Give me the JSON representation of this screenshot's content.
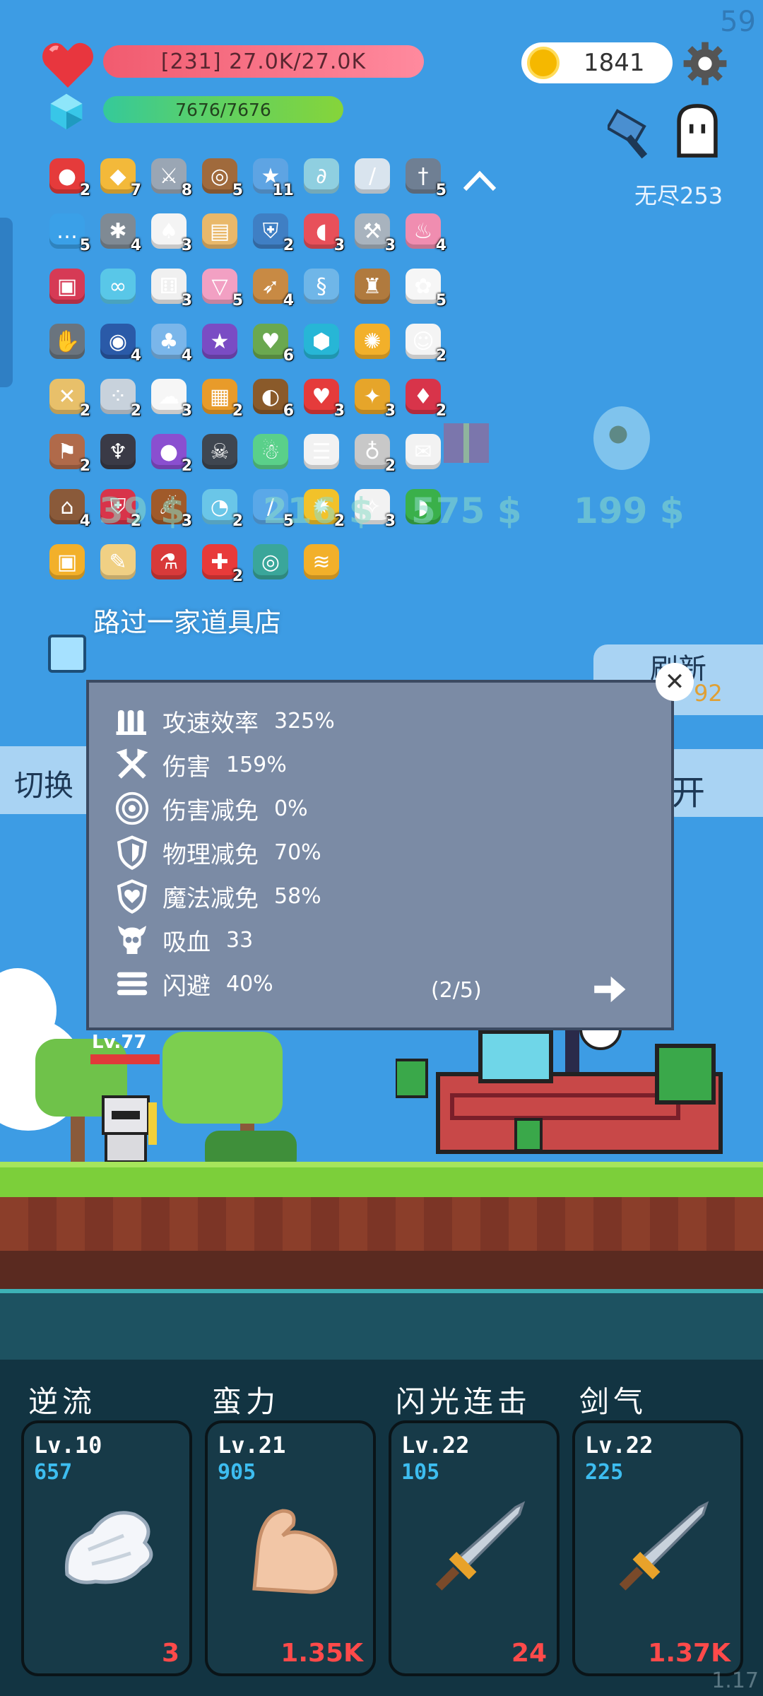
{
  "fps": "59",
  "hud": {
    "hp_text": "[231] 27.0K/27.0K",
    "mp_text": "7676/7676",
    "coins": "1841",
    "mode": "无尽253"
  },
  "items": [
    {
      "c": "#e53b3b",
      "g": "●",
      "n": "2"
    },
    {
      "c": "#f3b93a",
      "g": "◆",
      "n": "7"
    },
    {
      "c": "#9aa6b4",
      "g": "⚔",
      "n": "8"
    },
    {
      "c": "#a06a3c",
      "g": "◎",
      "n": "5"
    },
    {
      "c": "#5ea4e3",
      "g": "★",
      "n": "11"
    },
    {
      "c": "#8fcfe0",
      "g": "∂",
      "n": ""
    },
    {
      "c": "#d9e4ee",
      "g": "/",
      "n": ""
    },
    {
      "c": "#6f7f93",
      "g": "†",
      "n": "5"
    },
    {
      "c": "#3aa0e8",
      "g": "…",
      "n": "5"
    },
    {
      "c": "#7f8a94",
      "g": "✱",
      "n": "4"
    },
    {
      "c": "#f4f4f4",
      "g": "♠",
      "n": "3"
    },
    {
      "c": "#e9b86a",
      "g": "▤",
      "n": ""
    },
    {
      "c": "#3f7fc4",
      "g": "⛨",
      "n": "2"
    },
    {
      "c": "#e8505a",
      "g": "◖",
      "n": "3"
    },
    {
      "c": "#a8b3be",
      "g": "⚒",
      "n": "3"
    },
    {
      "c": "#f08db0",
      "g": "♨",
      "n": "4"
    },
    {
      "c": "#d63a55",
      "g": "▣",
      "n": ""
    },
    {
      "c": "#59c7e8",
      "g": "∞",
      "n": ""
    },
    {
      "c": "#f0f0f0",
      "g": "⚅",
      "n": "3"
    },
    {
      "c": "#f2a0c3",
      "g": "▽",
      "n": "5"
    },
    {
      "c": "#c88a44",
      "g": "➶",
      "n": "4"
    },
    {
      "c": "#6fb6e8",
      "g": "§",
      "n": ""
    },
    {
      "c": "#b07a3e",
      "g": "♜",
      "n": ""
    },
    {
      "c": "#f6f6f6",
      "g": "✿",
      "n": "5"
    },
    {
      "c": "#6a747e",
      "g": "✋",
      "n": ""
    },
    {
      "c": "#2a5aa8",
      "g": "◉",
      "n": "4"
    },
    {
      "c": "#7ab6ea",
      "g": "♣",
      "n": "4"
    },
    {
      "c": "#7a4cc4",
      "g": "★",
      "n": ""
    },
    {
      "c": "#6aa84f",
      "g": "♥",
      "n": "6"
    },
    {
      "c": "#27b6d6",
      "g": "⬢",
      "n": ""
    },
    {
      "c": "#f2b02a",
      "g": "✺",
      "n": ""
    },
    {
      "c": "#f4f4f4",
      "g": "☺",
      "n": "2"
    },
    {
      "c": "#e8c06a",
      "g": "✕",
      "n": "2"
    },
    {
      "c": "#c8d2dc",
      "g": "⁘",
      "n": "2"
    },
    {
      "c": "#f6f6f6",
      "g": "☁",
      "n": "3"
    },
    {
      "c": "#e89b2a",
      "g": "▦",
      "n": "2"
    },
    {
      "c": "#8a5a2a",
      "g": "◐",
      "n": "6"
    },
    {
      "c": "#e53b3b",
      "g": "♥",
      "n": "3"
    },
    {
      "c": "#e6a52a",
      "g": "✦",
      "n": "3"
    },
    {
      "c": "#d8344a",
      "g": "♦",
      "n": "2"
    },
    {
      "c": "#b06a4a",
      "g": "⚑",
      "n": "2"
    },
    {
      "c": "#3a3a46",
      "g": "♆",
      "n": ""
    },
    {
      "c": "#8a4fd0",
      "g": "●",
      "n": "2"
    },
    {
      "c": "#3f4650",
      "g": "☠",
      "n": ""
    },
    {
      "c": "#5ad08a",
      "g": "☃",
      "n": ""
    },
    {
      "c": "#f2f2f2",
      "g": "☰",
      "n": ""
    },
    {
      "c": "#c8c8c8",
      "g": "♁",
      "n": "2"
    },
    {
      "c": "#f2f2f2",
      "g": "✉",
      "n": ""
    },
    {
      "c": "#8a5a3a",
      "g": "⌂",
      "n": "4"
    },
    {
      "c": "#d8344a",
      "g": "⛨",
      "n": "2"
    },
    {
      "c": "#a05a2a",
      "g": "☄",
      "n": "3"
    },
    {
      "c": "#6ac6e8",
      "g": "◔",
      "n": "2"
    },
    {
      "c": "#5aa8e8",
      "g": "/",
      "n": "5"
    },
    {
      "c": "#f2c22a",
      "g": "✹",
      "n": "2"
    },
    {
      "c": "#f2f2f2",
      "g": "✧",
      "n": "3"
    },
    {
      "c": "#3ab04a",
      "g": "◗",
      "n": ""
    },
    {
      "c": "#f2b02a",
      "g": "▣",
      "n": ""
    },
    {
      "c": "#f0d084",
      "g": "✎",
      "n": ""
    },
    {
      "c": "#d83a3a",
      "g": "⚗",
      "n": ""
    },
    {
      "c": "#e83a3a",
      "g": "✚",
      "n": "2"
    },
    {
      "c": "#3aa69a",
      "g": "◎",
      "n": ""
    },
    {
      "c": "#f2b02a",
      "g": "≋",
      "n": ""
    }
  ],
  "shop": {
    "message": "路过一家道具店",
    "prices": [
      "39 $",
      "216 $",
      "575 $",
      "199 $"
    ],
    "refresh_label": "刷新",
    "refresh_cost": "92",
    "switch_label": "切换",
    "open_label": "开"
  },
  "stats": {
    "rows": [
      {
        "name": "攻速效率",
        "value": "325%"
      },
      {
        "name": "伤害",
        "value": "159%"
      },
      {
        "name": "伤害减免",
        "value": "0%"
      },
      {
        "name": "物理减免",
        "value": "70%"
      },
      {
        "name": "魔法减免",
        "value": "58%"
      },
      {
        "name": "吸血",
        "value": "33"
      },
      {
        "name": "闪避",
        "value": "40%"
      }
    ],
    "page": "(2/5)"
  },
  "enemy_level": "Lv.77",
  "skills": [
    {
      "name": "逆流",
      "lv": "Lv.10",
      "xp": "657",
      "cost": "3",
      "icon": "wing-icon"
    },
    {
      "name": "蛮力",
      "lv": "Lv.21",
      "xp": "905",
      "cost": "1.35K",
      "icon": "bicep-icon"
    },
    {
      "name": "闪光连击",
      "lv": "Lv.22",
      "xp": "105",
      "cost": "24",
      "icon": "sword-icon"
    },
    {
      "name": "剑气",
      "lv": "Lv.22",
      "xp": "225",
      "cost": "1.37K",
      "icon": "sword-icon"
    }
  ],
  "version": "1.17"
}
